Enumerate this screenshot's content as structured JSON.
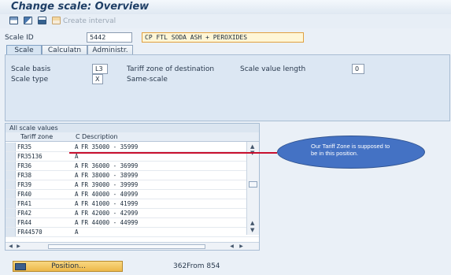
{
  "window": {
    "title": "Change scale: Overview"
  },
  "toolbar": {
    "icons": [
      "display-icon",
      "change-icon",
      "save-icon",
      "create-interval-icon"
    ],
    "create_interval_label": "Create interval"
  },
  "scale": {
    "id_label": "Scale ID",
    "id_value": "5442",
    "description_value": "CP FTL SODA ASH + PEROXIDES"
  },
  "tabs": [
    {
      "label": "Scale",
      "active": true
    },
    {
      "label": "Calculatn",
      "active": false
    },
    {
      "label": "Administr.",
      "active": false
    }
  ],
  "scale_panel": {
    "basis_label": "Scale basis",
    "basis_value": "L3",
    "basis_text": "Tariff zone of destination",
    "length_label": "Scale value length",
    "length_value": "0",
    "type_label": "Scale type",
    "type_value": "X",
    "type_text": "Same-scale"
  },
  "values_table": {
    "title": "All scale values",
    "columns": [
      "Tariff zone",
      "C",
      "Description"
    ],
    "rows": [
      {
        "zone": "FR35",
        "c": "A",
        "desc": "FR 35000 - 35999"
      },
      {
        "zone": "FR35136",
        "c": "A",
        "desc": ""
      },
      {
        "zone": "FR36",
        "c": "A",
        "desc": "FR 36000 - 36999"
      },
      {
        "zone": "FR38",
        "c": "A",
        "desc": "FR 38000 - 38999"
      },
      {
        "zone": "FR39",
        "c": "A",
        "desc": "FR 39000 - 39999"
      },
      {
        "zone": "FR40",
        "c": "A",
        "desc": "FR 40000 - 40999"
      },
      {
        "zone": "FR41",
        "c": "A",
        "desc": "FR 41000 - 41999"
      },
      {
        "zone": "FR42",
        "c": "A",
        "desc": "FR 42000 - 42999"
      },
      {
        "zone": "FR44",
        "c": "A",
        "desc": "FR 44000 - 44999"
      },
      {
        "zone": "FR44570",
        "c": "A",
        "desc": ""
      }
    ]
  },
  "annotation": {
    "text": "Our Tariff Zone is supposed to be in this position.",
    "line_color": "#c8102e",
    "bubble_color": "#4472c4"
  },
  "footer": {
    "position_label": "Position...",
    "count_text": "362From 854"
  }
}
